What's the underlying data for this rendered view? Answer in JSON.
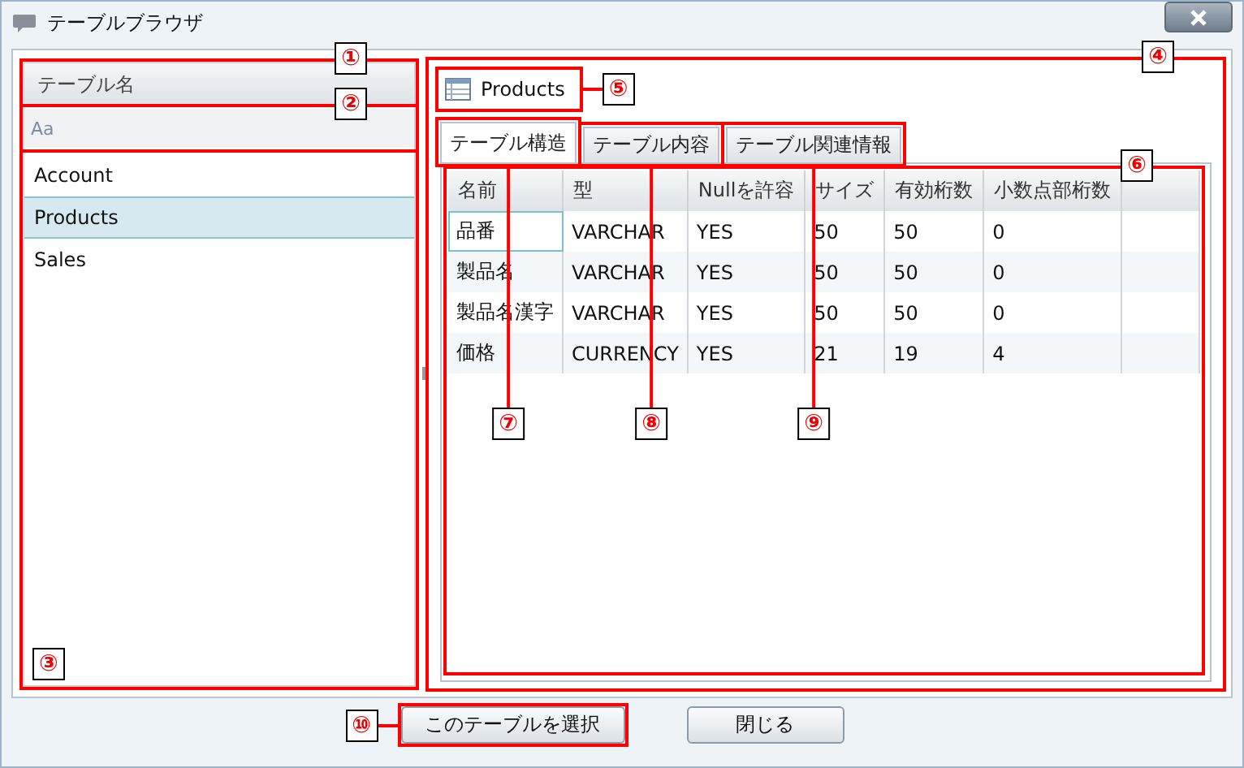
{
  "window": {
    "title": "テーブルブラウザ"
  },
  "left_panel": {
    "callout": "①",
    "header": "テーブル名",
    "filter": {
      "placeholder": "Aa",
      "callout": "②"
    },
    "list": {
      "callout": "③",
      "items": [
        {
          "label": "Account",
          "selected": false
        },
        {
          "label": "Products",
          "selected": true
        },
        {
          "label": "Sales",
          "selected": false
        }
      ]
    }
  },
  "right_panel": {
    "callout": "④",
    "title": {
      "text": "Products",
      "callout": "⑤"
    },
    "tabs": [
      {
        "label": "テーブル構造",
        "selected": true,
        "callout": "⑦"
      },
      {
        "label": "テーブル内容",
        "selected": false,
        "callout": "⑧"
      },
      {
        "label": "テーブル関連情報",
        "selected": false,
        "callout": "⑨"
      }
    ],
    "table": {
      "callout": "⑥",
      "columns": [
        "名前",
        "型",
        "Nullを許容",
        "サイズ",
        "有効桁数",
        "小数点部桁数"
      ],
      "rows": [
        {
          "cells": [
            "品番",
            "VARCHAR",
            "YES",
            "50",
            "50",
            "0"
          ],
          "focused": true
        },
        {
          "cells": [
            "製品名",
            "VARCHAR",
            "YES",
            "50",
            "50",
            "0"
          ],
          "focused": false
        },
        {
          "cells": [
            "製品名漢字",
            "VARCHAR",
            "YES",
            "50",
            "50",
            "0"
          ],
          "focused": false
        },
        {
          "cells": [
            "価格",
            "CURRENCY",
            "YES",
            "21",
            "19",
            "4"
          ],
          "focused": false
        }
      ]
    }
  },
  "buttons": [
    {
      "label": "このテーブルを選択",
      "callout": "⑩"
    },
    {
      "label": "閉じる"
    }
  ]
}
